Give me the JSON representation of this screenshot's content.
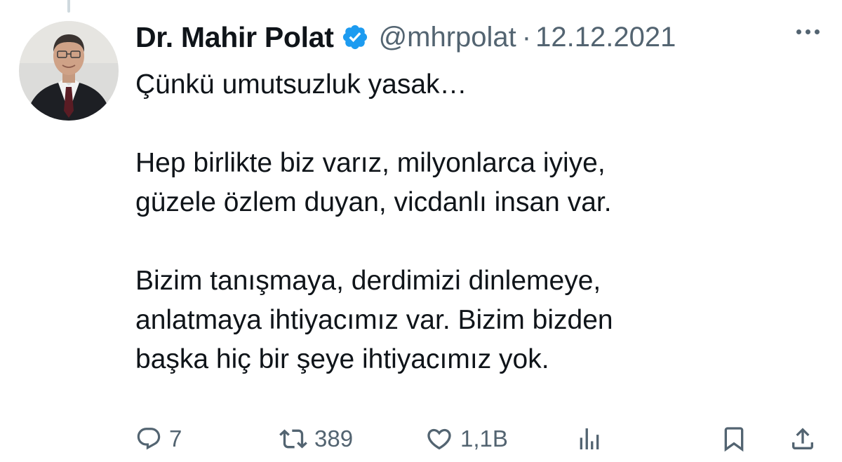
{
  "tweet": {
    "author_name": "Dr. Mahir Polat",
    "handle": "@mhrpolat",
    "separator": "·",
    "date": "12.12.2021",
    "verified": true,
    "text_paragraphs": [
      "Çünkü umutsuzluk yasak…",
      "Hep birlikte biz varız, milyonlarca iyiye, güzele özlem duyan, vicdanlı insan var.",
      "Bizim tanışmaya, derdimizi dinlemeye, anlatmaya ihtiyacımız var. Bizim bizden başka hiç bir şeye ihtiyacımız yok."
    ],
    "text_lines": {
      "l1": "Çünkü umutsuzluk yasak…",
      "l2": "Hep birlikte biz varız, milyonlarca iyiye,",
      "l3": "güzele özlem duyan, vicdanlı insan var.",
      "l4": "Bizim tanışmaya, derdimizi dinlemeye,",
      "l5": "anlatmaya ihtiyacımız var. Bizim bizden",
      "l6": "başka hiç bir şeye ihtiyacımız yok."
    }
  },
  "actions": {
    "reply": {
      "icon": "reply-icon",
      "count": "7"
    },
    "retweet": {
      "icon": "retweet-icon",
      "count": "389"
    },
    "like": {
      "icon": "heart-icon",
      "count": "1,1B"
    },
    "views": {
      "icon": "analytics-icon"
    },
    "bookmark": {
      "icon": "bookmark-icon"
    },
    "share": {
      "icon": "share-icon"
    }
  },
  "colors": {
    "text_primary": "#0f1419",
    "text_secondary": "#536471",
    "verified_blue": "#1d9bf0",
    "divider": "#cfd9de"
  }
}
